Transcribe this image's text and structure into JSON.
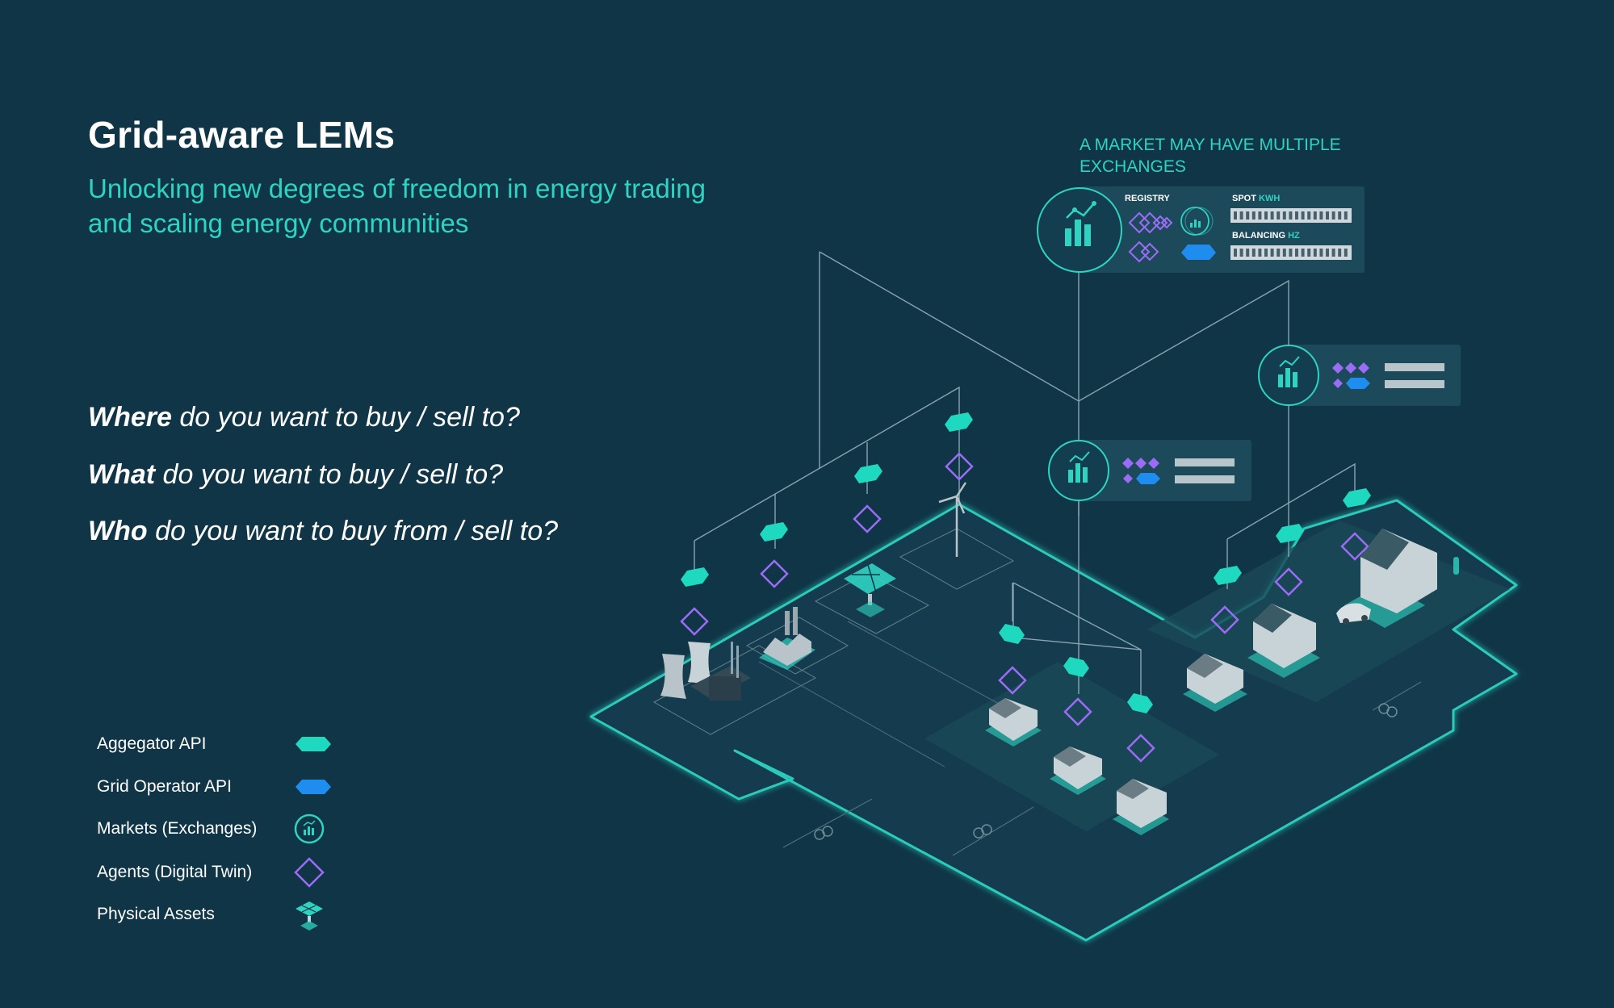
{
  "title": "Grid-aware LEMs",
  "subtitle_line1": "Unlocking new degrees of freedom in energy trading",
  "subtitle_line2": "and scaling energy communities",
  "questions": [
    {
      "bold": "Where",
      "rest": " do you want to buy / sell to?"
    },
    {
      "bold": "What",
      "rest": " do you want to buy / sell to?"
    },
    {
      "bold": "Who",
      "rest": " do you want to buy from / sell to?"
    }
  ],
  "legend": [
    {
      "label": "Aggegator API",
      "icon": "aggregator-api-icon",
      "color": "#1ed9c0"
    },
    {
      "label": "Grid Operator API",
      "icon": "grid-operator-api-icon",
      "color": "#1f8cf0"
    },
    {
      "label": "Markets (Exchanges)",
      "icon": "market-icon",
      "color": "#2ed3c2"
    },
    {
      "label": "Agents (Digital Twin)",
      "icon": "agent-diamond-icon",
      "color": "#9b6cf5"
    },
    {
      "label": "Physical Assets",
      "icon": "physical-asset-icon",
      "color": "#2ed3c2"
    }
  ],
  "callout": {
    "line1": "A MARKET MAY HAVE MULTIPLE",
    "line2": "EXCHANGES"
  },
  "exchange_panel": {
    "registry": "REGISTRY",
    "spot": "SPOT",
    "spot_unit": "KWH",
    "balancing": "BALANCING",
    "balancing_unit": "HZ"
  },
  "colors": {
    "background": "#0f3546",
    "teal": "#2ed3c2",
    "aggregator": "#1ed9c0",
    "grid_operator": "#1f8cf0",
    "agent": "#9b6cf5",
    "line": "#8aa4b0"
  }
}
